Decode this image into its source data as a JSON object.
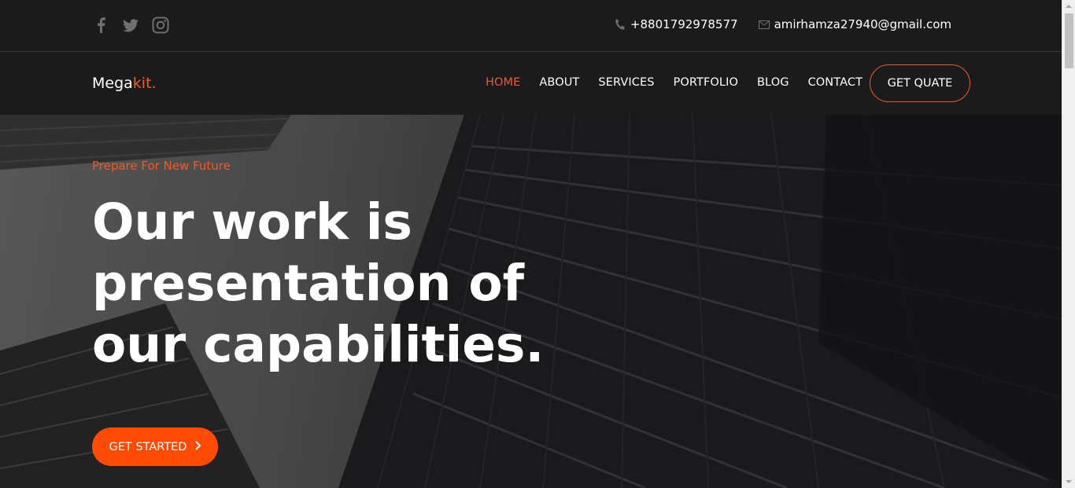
{
  "topbar": {
    "social": [
      {
        "icon": "facebook-icon"
      },
      {
        "icon": "twitter-icon"
      },
      {
        "icon": "instagram-icon"
      }
    ],
    "phone": "+8801792978577",
    "email": "amirhamza27940@gmail.com"
  },
  "navbar": {
    "logo_main": "Mega",
    "logo_accent": "kit.",
    "items": [
      {
        "label": "HOME",
        "active": true
      },
      {
        "label": "ABOUT"
      },
      {
        "label": "SERVICES"
      },
      {
        "label": "PORTFOLIO"
      },
      {
        "label": "BLOG"
      },
      {
        "label": "CONTACT"
      }
    ],
    "quote_label": "GET QUATE"
  },
  "hero": {
    "tagline": "Prepare For New Future",
    "headline": "Our work is presentation of our capabilities.",
    "cta_label": "GET STARTED",
    "cta_icon": "chevron-right-icon"
  },
  "colors": {
    "accent": "#f15a24",
    "cta": "#ff4b05",
    "dark": "#1b1b1b"
  }
}
